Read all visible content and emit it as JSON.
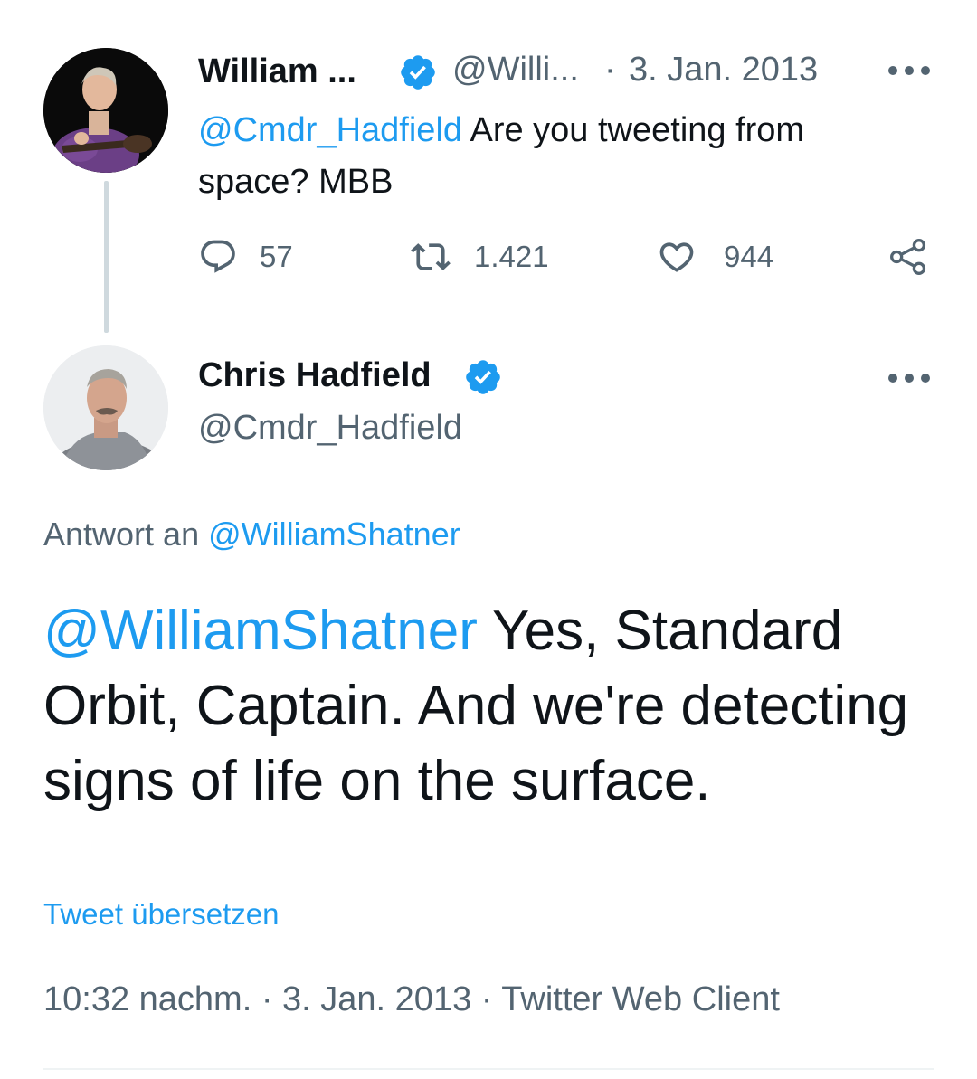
{
  "tweet1": {
    "author_name": "William ...",
    "handle": "@Willi...",
    "separator": "·",
    "date": "3. Jan. 2013",
    "mention": "@Cmdr_Hadfield",
    "text": " Are you tweeting from space? MBB",
    "stats": {
      "replies": "57",
      "retweets": "1.421",
      "likes": "944"
    }
  },
  "tweet2": {
    "author_name": "Chris Hadfield",
    "handle": "@Cmdr_Hadfield",
    "reply_prefix": "Antwort an ",
    "reply_handle": "@WilliamShatner",
    "mention": "@WilliamShatner",
    "text": " Yes, Standard Orbit, Captain. And we're detecting signs of life on the surface.",
    "translate_label": "Tweet übersetzen",
    "meta": "10:32 nachm. · 3. Jan. 2013 · Twitter Web Client"
  },
  "icons": {
    "verified": "verified-badge-icon",
    "more": "more-options-icon",
    "reply": "reply-icon",
    "retweet": "retweet-icon",
    "like": "heart-icon",
    "share": "share-icon"
  },
  "colors": {
    "link": "#1d9bf0",
    "muted": "#536471",
    "text": "#0f1419",
    "thread_line": "#cfd9de"
  }
}
